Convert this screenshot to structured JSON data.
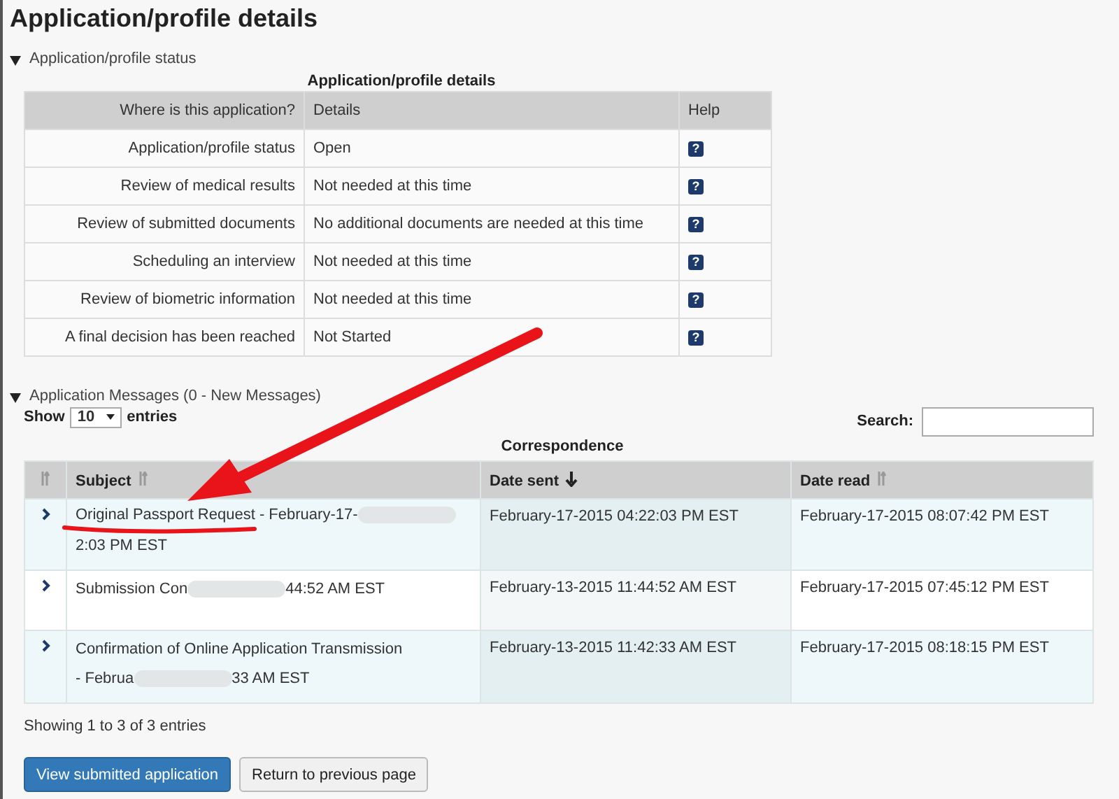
{
  "title": "Application/profile details",
  "status_section": {
    "label": "Application/profile status",
    "expanded": true,
    "caption": "Application/profile details",
    "columns": [
      "Where is this application?",
      "Details",
      "Help"
    ],
    "rows": [
      {
        "stage": "Application/profile status",
        "details": "Open",
        "help": "?"
      },
      {
        "stage": "Review of medical results",
        "details": "Not needed at this time",
        "help": "?"
      },
      {
        "stage": "Review of submitted documents",
        "details": "No additional documents are needed at this time",
        "help": "?"
      },
      {
        "stage": "Scheduling an interview",
        "details": "Not needed at this time",
        "help": "?"
      },
      {
        "stage": "Review of biometric information",
        "details": "Not needed at this time",
        "help": "?"
      },
      {
        "stage": "A final decision has been reached",
        "details": "Not Started",
        "help": "?"
      }
    ]
  },
  "messages_section": {
    "label": "Application Messages (0 - New Messages)",
    "expanded": true,
    "show_label": "Show",
    "page_size": "10",
    "entries_label": "entries",
    "search_label": "Search:",
    "caption": "Correspondence",
    "columns": [
      {
        "sorted_descending": false
      },
      {
        "label": "Subject",
        "sorted_descending": false
      },
      {
        "label": "Date sent",
        "sorted_descending": true
      },
      {
        "label": "Date read",
        "sorted_descending": false
      }
    ],
    "rows": [
      {
        "subject": [
          {
            "kind": "text",
            "text": "Original Passport Request - February-17-"
          },
          {
            "kind": "redacted"
          },
          {
            "kind": "text",
            "text": "2:03 PM EST"
          }
        ],
        "date_sent": "February-17-2015 04:22:03 PM EST",
        "date_read": "February-17-2015 08:07:42 PM EST"
      },
      {
        "subject": [
          {
            "kind": "text",
            "text": "Submission Con"
          },
          {
            "kind": "redacted"
          },
          {
            "kind": "text",
            "text": "44:52 AM EST"
          }
        ],
        "date_sent": "February-13-2015 11:44:52 AM EST",
        "date_read": "February-17-2015 07:45:12 PM EST"
      },
      {
        "subject": [
          {
            "kind": "text",
            "text": "Confirmation of Online Application Transmission"
          },
          {
            "kind": "break"
          },
          {
            "kind": "text",
            "text": "- Februa"
          },
          {
            "kind": "redacted"
          },
          {
            "kind": "text",
            "text": "33 AM EST"
          }
        ],
        "date_sent": "February-13-2015 11:42:33 AM EST",
        "date_read": "February-17-2015 08:18:15 PM EST"
      }
    ],
    "info": "Showing 1 to 3 of 3 entries"
  },
  "buttons": [
    {
      "label": "View submitted application",
      "kind": "primary"
    },
    {
      "label": "Return to previous page",
      "kind": "default"
    }
  ]
}
